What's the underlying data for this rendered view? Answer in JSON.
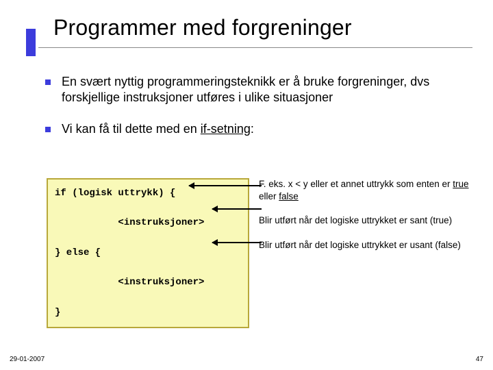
{
  "title": "Programmer med forgreninger",
  "bullets": [
    "En svært nyttig programmeringsteknikk er å bruke forgreninger, dvs forskjellige instruksjoner utføres i ulike situasjoner",
    {
      "pre": "Vi kan få til dette med en ",
      "u": "if-setning",
      "post": ":"
    }
  ],
  "code": "if (logisk uttrykk) {\n\n           <instruksjoner>\n\n} else {\n\n           <instruksjoner>\n\n}",
  "annotations": {
    "a1_pre": "F. eks. x < y eller et annet uttrykk som enten er ",
    "a1_u1": "true",
    "a1_mid": " eller ",
    "a1_u2": "false",
    "a2": "Blir utført når det logiske uttrykket er sant (true)",
    "a3": "Blir utført når det logiske uttrykket er usant (false)"
  },
  "footer": {
    "date": "29-01-2007",
    "page": "47"
  }
}
